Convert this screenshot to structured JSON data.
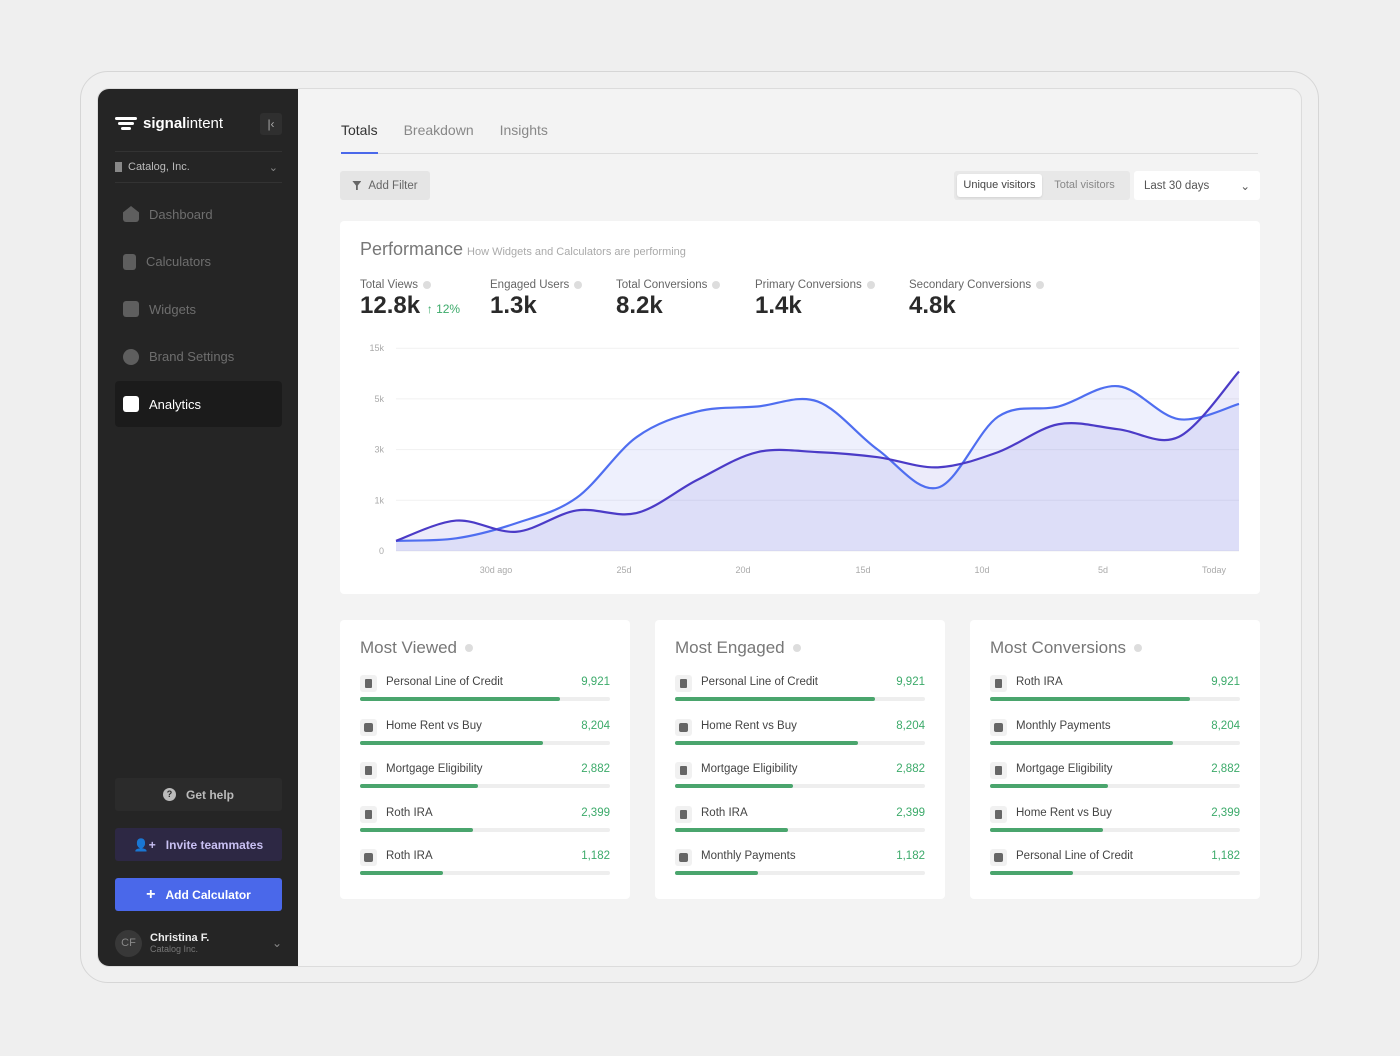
{
  "brand": {
    "name_bold": "signal",
    "name_light": "intent"
  },
  "sidebar": {
    "org": "Catalog, Inc.",
    "items": [
      {
        "label": "Dashboard",
        "icon": "home-icon",
        "active": false
      },
      {
        "label": "Calculators",
        "icon": "calculator-icon",
        "active": false
      },
      {
        "label": "Widgets",
        "icon": "widget-plus-icon",
        "active": false
      },
      {
        "label": "Brand Settings",
        "icon": "palette-icon",
        "active": false
      },
      {
        "label": "Analytics",
        "icon": "bar-chart-icon",
        "active": true
      }
    ],
    "help": "Get help",
    "invite": "Invite teammates",
    "add": "Add Calculator",
    "user": {
      "initials": "CF",
      "name": "Christina F.",
      "org": "Catalog Inc."
    }
  },
  "tabs": [
    "Totals",
    "Breakdown",
    "Insights"
  ],
  "toolbar": {
    "filter": "Add Filter",
    "seg": [
      "Unique visitors",
      "Total visitors"
    ],
    "range": "Last 30 days"
  },
  "performance": {
    "title": "Performance",
    "subtitle": "How Widgets and Calculators are performing",
    "kpis": [
      {
        "label": "Total Views",
        "value": "12.8k",
        "delta": "↑ 12%"
      },
      {
        "label": "Engaged Users",
        "value": "1.3k"
      },
      {
        "label": "Total Conversions",
        "value": "8.2k"
      },
      {
        "label": "Primary Conversions",
        "value": "1.4k"
      },
      {
        "label": "Secondary Conversions",
        "value": "4.8k"
      }
    ]
  },
  "chart_data": {
    "type": "area",
    "yticks": [
      "0",
      "1k",
      "3k",
      "5k",
      "15k"
    ],
    "ytick_values": [
      0,
      1000,
      3000,
      5000,
      15000
    ],
    "xticks": [
      "30d ago",
      "25d",
      "20d",
      "15d",
      "10d",
      "5d",
      "Today"
    ],
    "grid": true,
    "colors": [
      "#4f6ef0",
      "#4b3bc7"
    ],
    "series": [
      {
        "values": [
          200,
          250,
          550,
          1100,
          3500,
          4500,
          4700,
          4900,
          3000,
          1500,
          4300,
          4700,
          7500,
          4200,
          4800
        ]
      },
      {
        "values": [
          200,
          600,
          380,
          800,
          750,
          1800,
          2900,
          2900,
          2700,
          2300,
          2900,
          4000,
          3800,
          3500,
          10400
        ]
      }
    ]
  },
  "lists": [
    {
      "title": "Most Viewed",
      "rows": [
        {
          "name": "Personal Line of Credit",
          "value": "9,921",
          "pct": 80,
          "icon": "calculator"
        },
        {
          "name": "Home Rent vs Buy",
          "value": "8,204",
          "pct": 73,
          "icon": "widget"
        },
        {
          "name": "Mortgage Eligibility",
          "value": "2,882",
          "pct": 47,
          "icon": "calculator"
        },
        {
          "name": "Roth IRA",
          "value": "2,399",
          "pct": 45,
          "icon": "calculator"
        },
        {
          "name": "Roth IRA",
          "value": "1,182",
          "pct": 33,
          "icon": "widget"
        }
      ]
    },
    {
      "title": "Most Engaged",
      "rows": [
        {
          "name": "Personal Line of Credit",
          "value": "9,921",
          "pct": 80,
          "icon": "calculator"
        },
        {
          "name": "Home Rent vs Buy",
          "value": "8,204",
          "pct": 73,
          "icon": "widget"
        },
        {
          "name": "Mortgage Eligibility",
          "value": "2,882",
          "pct": 47,
          "icon": "calculator"
        },
        {
          "name": "Roth IRA",
          "value": "2,399",
          "pct": 45,
          "icon": "calculator"
        },
        {
          "name": "Monthly Payments",
          "value": "1,182",
          "pct": 33,
          "icon": "widget"
        }
      ]
    },
    {
      "title": "Most Conversions",
      "rows": [
        {
          "name": "Roth IRA",
          "value": "9,921",
          "pct": 80,
          "icon": "calculator"
        },
        {
          "name": "Monthly Payments",
          "value": "8,204",
          "pct": 73,
          "icon": "widget"
        },
        {
          "name": "Mortgage Eligibility",
          "value": "2,882",
          "pct": 47,
          "icon": "calculator"
        },
        {
          "name": "Home Rent vs Buy",
          "value": "2,399",
          "pct": 45,
          "icon": "calculator"
        },
        {
          "name": "Personal Line of Credit",
          "value": "1,182",
          "pct": 33,
          "icon": "widget"
        }
      ]
    }
  ]
}
